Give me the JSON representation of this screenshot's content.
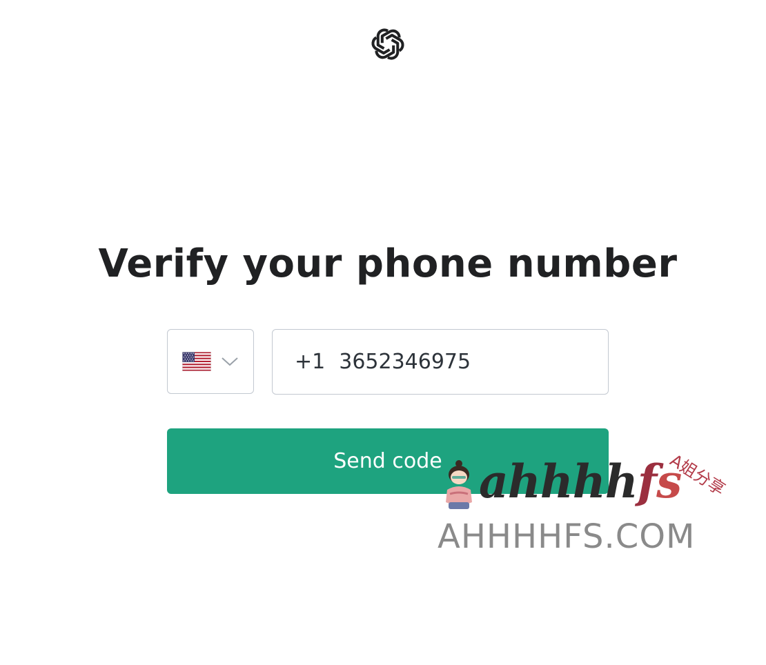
{
  "logo": {
    "icon": "openai-logo-icon"
  },
  "page": {
    "title": "Verify your phone number"
  },
  "country_select": {
    "flag_icon": "us-flag-icon",
    "chevron_icon": "chevron-down-icon"
  },
  "phone": {
    "dial_code": "+1",
    "number": "3652346975"
  },
  "send_button": {
    "label": "Send code"
  },
  "colors": {
    "accent": "#1ea37f",
    "text": "#202123",
    "border": "#c2c8d0"
  },
  "watermark": {
    "script_main": "ahhhh",
    "script_f": "f",
    "script_s": "s",
    "chinese": "A姐分享",
    "domain": "AHHHHFS.COM"
  }
}
